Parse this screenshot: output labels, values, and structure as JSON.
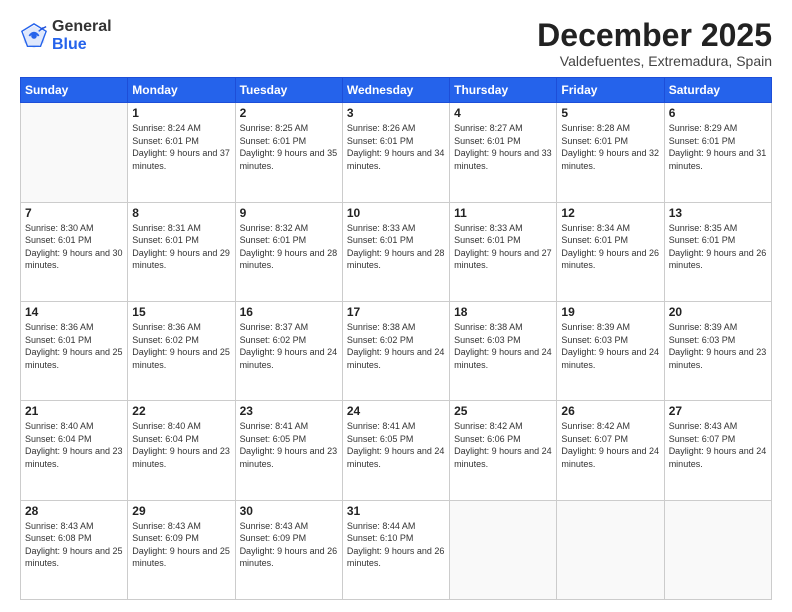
{
  "logo": {
    "general": "General",
    "blue": "Blue"
  },
  "header": {
    "month": "December 2025",
    "location": "Valdefuentes, Extremadura, Spain"
  },
  "weekdays": [
    "Sunday",
    "Monday",
    "Tuesday",
    "Wednesday",
    "Thursday",
    "Friday",
    "Saturday"
  ],
  "weeks": [
    [
      {
        "day": "",
        "sunrise": "",
        "sunset": "",
        "daylight": ""
      },
      {
        "day": "1",
        "sunrise": "Sunrise: 8:24 AM",
        "sunset": "Sunset: 6:01 PM",
        "daylight": "Daylight: 9 hours and 37 minutes."
      },
      {
        "day": "2",
        "sunrise": "Sunrise: 8:25 AM",
        "sunset": "Sunset: 6:01 PM",
        "daylight": "Daylight: 9 hours and 35 minutes."
      },
      {
        "day": "3",
        "sunrise": "Sunrise: 8:26 AM",
        "sunset": "Sunset: 6:01 PM",
        "daylight": "Daylight: 9 hours and 34 minutes."
      },
      {
        "day": "4",
        "sunrise": "Sunrise: 8:27 AM",
        "sunset": "Sunset: 6:01 PM",
        "daylight": "Daylight: 9 hours and 33 minutes."
      },
      {
        "day": "5",
        "sunrise": "Sunrise: 8:28 AM",
        "sunset": "Sunset: 6:01 PM",
        "daylight": "Daylight: 9 hours and 32 minutes."
      },
      {
        "day": "6",
        "sunrise": "Sunrise: 8:29 AM",
        "sunset": "Sunset: 6:01 PM",
        "daylight": "Daylight: 9 hours and 31 minutes."
      }
    ],
    [
      {
        "day": "7",
        "sunrise": "Sunrise: 8:30 AM",
        "sunset": "Sunset: 6:01 PM",
        "daylight": "Daylight: 9 hours and 30 minutes."
      },
      {
        "day": "8",
        "sunrise": "Sunrise: 8:31 AM",
        "sunset": "Sunset: 6:01 PM",
        "daylight": "Daylight: 9 hours and 29 minutes."
      },
      {
        "day": "9",
        "sunrise": "Sunrise: 8:32 AM",
        "sunset": "Sunset: 6:01 PM",
        "daylight": "Daylight: 9 hours and 28 minutes."
      },
      {
        "day": "10",
        "sunrise": "Sunrise: 8:33 AM",
        "sunset": "Sunset: 6:01 PM",
        "daylight": "Daylight: 9 hours and 28 minutes."
      },
      {
        "day": "11",
        "sunrise": "Sunrise: 8:33 AM",
        "sunset": "Sunset: 6:01 PM",
        "daylight": "Daylight: 9 hours and 27 minutes."
      },
      {
        "day": "12",
        "sunrise": "Sunrise: 8:34 AM",
        "sunset": "Sunset: 6:01 PM",
        "daylight": "Daylight: 9 hours and 26 minutes."
      },
      {
        "day": "13",
        "sunrise": "Sunrise: 8:35 AM",
        "sunset": "Sunset: 6:01 PM",
        "daylight": "Daylight: 9 hours and 26 minutes."
      }
    ],
    [
      {
        "day": "14",
        "sunrise": "Sunrise: 8:36 AM",
        "sunset": "Sunset: 6:01 PM",
        "daylight": "Daylight: 9 hours and 25 minutes."
      },
      {
        "day": "15",
        "sunrise": "Sunrise: 8:36 AM",
        "sunset": "Sunset: 6:02 PM",
        "daylight": "Daylight: 9 hours and 25 minutes."
      },
      {
        "day": "16",
        "sunrise": "Sunrise: 8:37 AM",
        "sunset": "Sunset: 6:02 PM",
        "daylight": "Daylight: 9 hours and 24 minutes."
      },
      {
        "day": "17",
        "sunrise": "Sunrise: 8:38 AM",
        "sunset": "Sunset: 6:02 PM",
        "daylight": "Daylight: 9 hours and 24 minutes."
      },
      {
        "day": "18",
        "sunrise": "Sunrise: 8:38 AM",
        "sunset": "Sunset: 6:03 PM",
        "daylight": "Daylight: 9 hours and 24 minutes."
      },
      {
        "day": "19",
        "sunrise": "Sunrise: 8:39 AM",
        "sunset": "Sunset: 6:03 PM",
        "daylight": "Daylight: 9 hours and 24 minutes."
      },
      {
        "day": "20",
        "sunrise": "Sunrise: 8:39 AM",
        "sunset": "Sunset: 6:03 PM",
        "daylight": "Daylight: 9 hours and 23 minutes."
      }
    ],
    [
      {
        "day": "21",
        "sunrise": "Sunrise: 8:40 AM",
        "sunset": "Sunset: 6:04 PM",
        "daylight": "Daylight: 9 hours and 23 minutes."
      },
      {
        "day": "22",
        "sunrise": "Sunrise: 8:40 AM",
        "sunset": "Sunset: 6:04 PM",
        "daylight": "Daylight: 9 hours and 23 minutes."
      },
      {
        "day": "23",
        "sunrise": "Sunrise: 8:41 AM",
        "sunset": "Sunset: 6:05 PM",
        "daylight": "Daylight: 9 hours and 23 minutes."
      },
      {
        "day": "24",
        "sunrise": "Sunrise: 8:41 AM",
        "sunset": "Sunset: 6:05 PM",
        "daylight": "Daylight: 9 hours and 24 minutes."
      },
      {
        "day": "25",
        "sunrise": "Sunrise: 8:42 AM",
        "sunset": "Sunset: 6:06 PM",
        "daylight": "Daylight: 9 hours and 24 minutes."
      },
      {
        "day": "26",
        "sunrise": "Sunrise: 8:42 AM",
        "sunset": "Sunset: 6:07 PM",
        "daylight": "Daylight: 9 hours and 24 minutes."
      },
      {
        "day": "27",
        "sunrise": "Sunrise: 8:43 AM",
        "sunset": "Sunset: 6:07 PM",
        "daylight": "Daylight: 9 hours and 24 minutes."
      }
    ],
    [
      {
        "day": "28",
        "sunrise": "Sunrise: 8:43 AM",
        "sunset": "Sunset: 6:08 PM",
        "daylight": "Daylight: 9 hours and 25 minutes."
      },
      {
        "day": "29",
        "sunrise": "Sunrise: 8:43 AM",
        "sunset": "Sunset: 6:09 PM",
        "daylight": "Daylight: 9 hours and 25 minutes."
      },
      {
        "day": "30",
        "sunrise": "Sunrise: 8:43 AM",
        "sunset": "Sunset: 6:09 PM",
        "daylight": "Daylight: 9 hours and 26 minutes."
      },
      {
        "day": "31",
        "sunrise": "Sunrise: 8:44 AM",
        "sunset": "Sunset: 6:10 PM",
        "daylight": "Daylight: 9 hours and 26 minutes."
      },
      {
        "day": "",
        "sunrise": "",
        "sunset": "",
        "daylight": ""
      },
      {
        "day": "",
        "sunrise": "",
        "sunset": "",
        "daylight": ""
      },
      {
        "day": "",
        "sunrise": "",
        "sunset": "",
        "daylight": ""
      }
    ]
  ]
}
